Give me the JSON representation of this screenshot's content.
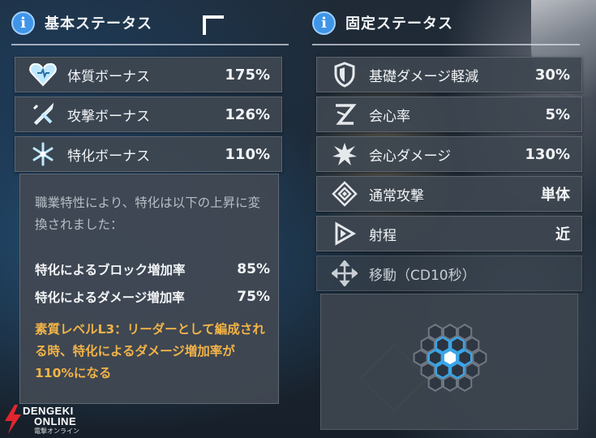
{
  "basic": {
    "title": "基本ステータス",
    "rows": [
      {
        "label": "体質ボーナス",
        "value": "175%",
        "icon": "heart-icon"
      },
      {
        "label": "攻撃ボーナス",
        "value": "126%",
        "icon": "crossed-swords-icon"
      },
      {
        "label": "特化ボーナス",
        "value": "110%",
        "icon": "snowflake-icon"
      }
    ],
    "tooltip": {
      "description": "職業特性により、特化は以下の上昇に変換されました：",
      "items": [
        {
          "label": "特化によるブロック増加率",
          "value": "85%"
        },
        {
          "label": "特化によるダメージ増加率",
          "value": "75%"
        }
      ],
      "note": "素質レベルL3：リーダーとして編成される時、特化によるダメージ増加率が110%になる"
    }
  },
  "fixed": {
    "title": "固定ステータス",
    "rows": [
      {
        "label": "基礎ダメージ軽減",
        "value": "30%",
        "icon": "shield-icon"
      },
      {
        "label": "会心率",
        "value": "5%",
        "icon": "crit-rate-icon"
      },
      {
        "label": "会心ダメージ",
        "value": "130%",
        "icon": "burst-icon"
      },
      {
        "label": "通常攻撃",
        "value": "単体",
        "icon": "attack-pattern-icon"
      },
      {
        "label": "射程",
        "value": "近",
        "icon": "range-icon"
      },
      {
        "label": "移動（CD10秒）",
        "value": "",
        "icon": "move-arrows-icon"
      }
    ]
  },
  "watermark": {
    "line1": "DENGEKI",
    "line2": "ONLINE",
    "line3": "電撃オンライン"
  },
  "colors": {
    "info_icon": "#3f95e8",
    "accent_note": "#f2b347",
    "hex_highlight": "#3aa6e8"
  }
}
